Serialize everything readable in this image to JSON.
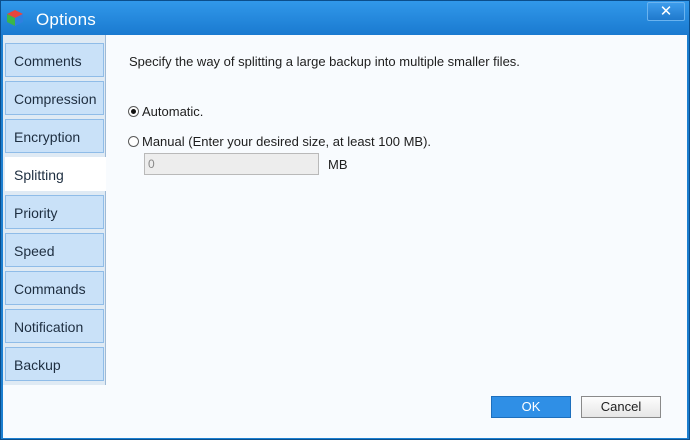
{
  "window": {
    "title": "Options",
    "close_label": "✕",
    "icon": "app-cube-icon"
  },
  "sidebar": {
    "items": [
      {
        "label": "Comments",
        "active": false
      },
      {
        "label": "Compression",
        "active": false
      },
      {
        "label": "Encryption",
        "active": false
      },
      {
        "label": "Splitting",
        "active": true
      },
      {
        "label": "Priority",
        "active": false
      },
      {
        "label": "Speed",
        "active": false
      },
      {
        "label": "Commands",
        "active": false
      },
      {
        "label": "Notification",
        "active": false
      },
      {
        "label": "Backup",
        "active": false
      }
    ]
  },
  "splitting": {
    "description": "Specify the way of splitting a large backup into multiple smaller files.",
    "automatic_label": "Automatic.",
    "automatic_checked": true,
    "manual_label": "Manual (Enter your desired size, at least 100 MB).",
    "manual_checked": false,
    "size_value": "0",
    "size_unit": "MB"
  },
  "buttons": {
    "ok_label": "OK",
    "cancel_label": "Cancel"
  },
  "colors": {
    "titlebar": "#1f7fd6",
    "nav_tab": "#c9e1f8",
    "ok_button": "#2f8fe6"
  }
}
